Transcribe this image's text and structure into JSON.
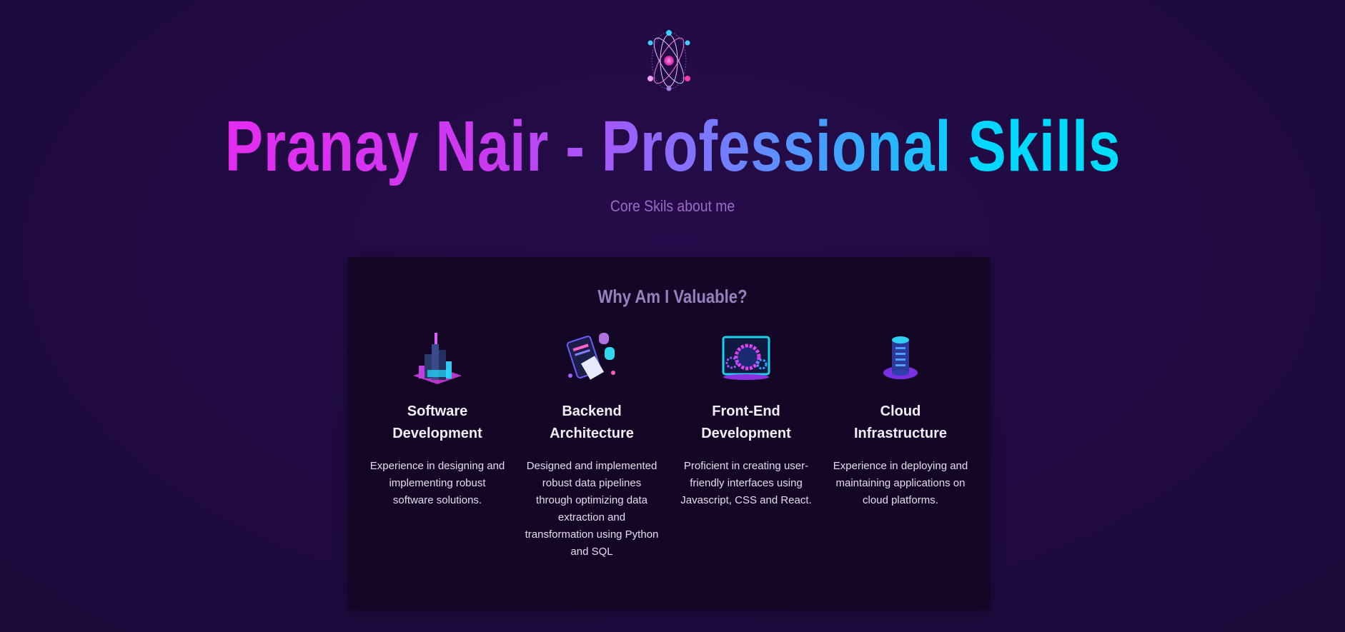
{
  "header": {
    "logo_icon": "atom-icon",
    "title": "Pranay Nair - Professional Skills",
    "subtitle": "Core Skils about me"
  },
  "colors": {
    "background": "#200a40",
    "card": "#140726",
    "gradient_start": "#e52cf0",
    "gradient_end": "#00dcfa"
  },
  "card": {
    "title": "Why Am I Valuable?",
    "skills": [
      {
        "icon": "city-blocks-icon",
        "title_line1": "Software",
        "title_line2": "Development",
        "description": "Experience in designing and implementing robust software solutions."
      },
      {
        "icon": "tablet-database-icon",
        "title_line1": "Backend",
        "title_line2": "Architecture",
        "description": "Designed and implemented robust data pipelines through optimizing data extraction and transformation using Python and SQL"
      },
      {
        "icon": "monitor-gears-icon",
        "title_line1": "Front-End",
        "title_line2": "Development",
        "description": "Proficient in creating user-friendly interfaces using Javascript, CSS and React."
      },
      {
        "icon": "server-cylinder-icon",
        "title_line1": "Cloud",
        "title_line2": "Infrastructure",
        "description": "Experience in deploying and maintaining applications on cloud platforms."
      }
    ]
  }
}
